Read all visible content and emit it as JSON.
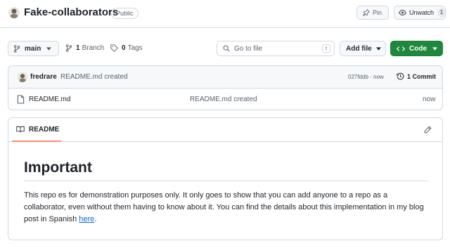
{
  "repo": {
    "name": "Fake-collaborators",
    "visibility": "Public",
    "avatar_icon": "user-avatar"
  },
  "actions": {
    "pin_label": "Pin",
    "watch_label": "Unwatch",
    "watch_count": "1"
  },
  "toolbar": {
    "branch_label": "main",
    "branch_count": "1",
    "branch_word": "Branch",
    "tag_count": "0",
    "tag_word": "Tags",
    "goto_placeholder": "Go to file",
    "goto_shortcut": "t",
    "add_file_label": "Add file",
    "code_label": "Code"
  },
  "latest_commit": {
    "author": "fredrare",
    "message": "README.md created",
    "hash_time": "027fddb · now",
    "commit_count_label": "1 Commit"
  },
  "files": [
    {
      "name": "README.md",
      "commit_message": "README.md created",
      "age": "now"
    }
  ],
  "readme": {
    "tab_label": "README",
    "title": "Important",
    "body_text": "This repo es for demonstration purposes only. It only goes to show that you can add anyone to a repo as a collaborator, even without them having to know about it. You can find the details about this implementation in my blog post in Spanish ",
    "link_text": "here",
    "trailing": "."
  },
  "colors": {
    "accent_green": "#1f883d",
    "link_blue": "#0969da",
    "tab_underline": "#fd8c73",
    "border": "#d1d9e0"
  }
}
